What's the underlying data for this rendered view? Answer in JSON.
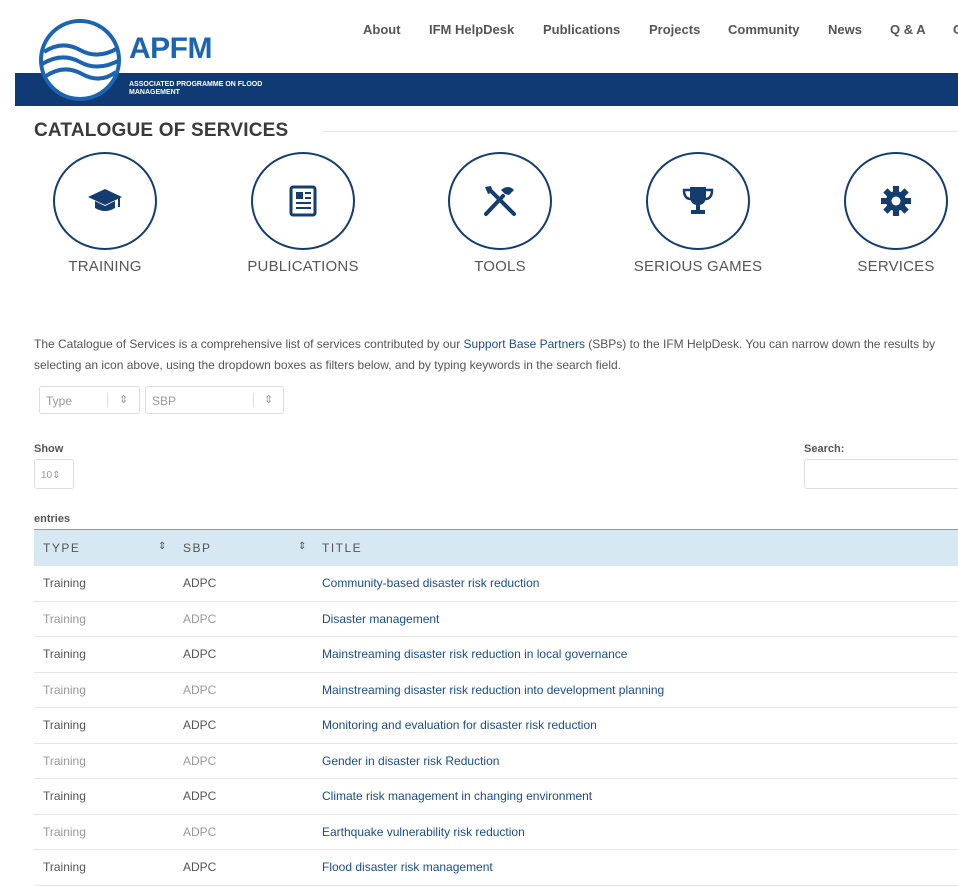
{
  "brand": {
    "name": "APFM",
    "subtitle": "ASSOCIATED PROGRAMME ON FLOOD MANAGEMENT",
    "accent": "#0f3a73",
    "logo_blue": "#1c64b2"
  },
  "nav": [
    {
      "label": "About"
    },
    {
      "label": "IFM HelpDesk"
    },
    {
      "label": "Publications"
    },
    {
      "label": "Projects"
    },
    {
      "label": "Community"
    },
    {
      "label": "News"
    },
    {
      "label": "Q & A"
    },
    {
      "label": "C"
    }
  ],
  "page_title": "CATALOGUE OF SERVICES",
  "categories": [
    {
      "label": "TRAINING",
      "icon": "graduation-cap-icon"
    },
    {
      "label": "PUBLICATIONS",
      "icon": "newspaper-icon"
    },
    {
      "label": "TOOLS",
      "icon": "tools-icon"
    },
    {
      "label": "SERIOUS GAMES",
      "icon": "trophy-icon"
    },
    {
      "label": "SERVICES",
      "icon": "gear-icon"
    }
  ],
  "description": {
    "before": "The Catalogue of Services is a comprehensive list of services contributed by our ",
    "link": "Support Base Partners",
    "after": " (SBPs) to the IFM HelpDesk. You can narrow down the results by selecting an icon above, using the dropdown boxes as filters below, and by typing keywords in the search field."
  },
  "filters": {
    "type": "Type",
    "sbp": "SBP"
  },
  "table_controls": {
    "show": "Show",
    "length": "10",
    "search": "Search:",
    "entries": "entries"
  },
  "table": {
    "headers": [
      "TYPE",
      "SBP",
      "TITLE"
    ],
    "rows": [
      [
        "Training",
        "ADPC",
        "Community-based disaster risk reduction"
      ],
      [
        "Training",
        "ADPC",
        "Disaster management"
      ],
      [
        "Training",
        "ADPC",
        "Mainstreaming disaster risk reduction in local governance"
      ],
      [
        "Training",
        "ADPC",
        "Mainstreaming disaster risk reduction into development planning"
      ],
      [
        "Training",
        "ADPC",
        "Monitoring and evaluation for disaster risk reduction"
      ],
      [
        "Training",
        "ADPC",
        "Gender in disaster risk Reduction"
      ],
      [
        "Training",
        "ADPC",
        "Climate risk management in changing environment"
      ],
      [
        "Training",
        "ADPC",
        "Earthquake vulnerability risk reduction"
      ],
      [
        "Training",
        "ADPC",
        "Flood disaster risk management"
      ]
    ]
  }
}
